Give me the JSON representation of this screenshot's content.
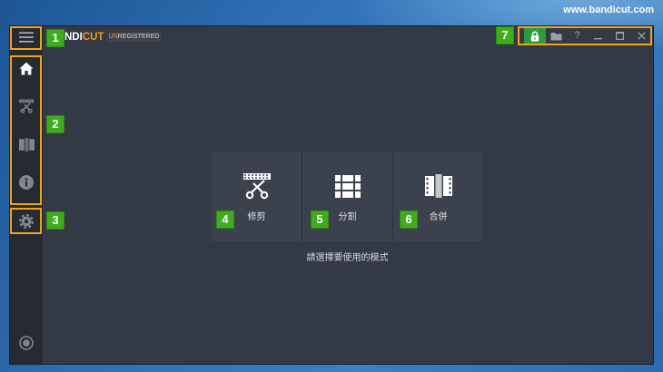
{
  "website": {
    "url": "www.bandicut.com"
  },
  "app": {
    "logo": {
      "main": "NDI",
      "accent": "CUT"
    },
    "license": {
      "accent": "UN",
      "rest": "REGISTERED"
    },
    "menu": {
      "icon": "hamburger-menu-icon"
    },
    "sidebar": {
      "items": [
        {
          "icon": "home-icon",
          "active": true
        },
        {
          "icon": "scissors-film-icon",
          "active": false
        },
        {
          "icon": "film-join-icon",
          "active": false
        },
        {
          "icon": "info-icon",
          "active": false
        }
      ],
      "settings": {
        "icon": "gear-icon"
      },
      "record": {
        "icon": "record-icon"
      }
    },
    "window_controls": {
      "lock": {
        "icon": "lock-icon"
      },
      "folder": {
        "icon": "folder-icon"
      },
      "help": {
        "label": "?"
      },
      "minimize": {
        "icon": "minimize-icon"
      },
      "maximize": {
        "icon": "maximize-icon"
      },
      "close": {
        "icon": "close-icon"
      }
    },
    "modes": [
      {
        "label": "修剪",
        "icon": "scissors-film-icon"
      },
      {
        "label": "分割",
        "icon": "split-grid-icon"
      },
      {
        "label": "合併",
        "icon": "film-join-icon"
      }
    ],
    "prompt": "請選擇要使用的模式"
  },
  "annotations": {
    "badges": [
      "1",
      "2",
      "3",
      "4",
      "5",
      "6",
      "7"
    ]
  },
  "colors": {
    "window_bg": "#343a45",
    "sidebar_bg": "#262a31",
    "tile_bg": "#3c424d",
    "tile_divider": "#2c3139",
    "badge_green": "#3fac1e",
    "highlight_orange": "#f1a31c",
    "logo_orange": "#f39b1f",
    "lock_green": "#2e9a3c"
  }
}
